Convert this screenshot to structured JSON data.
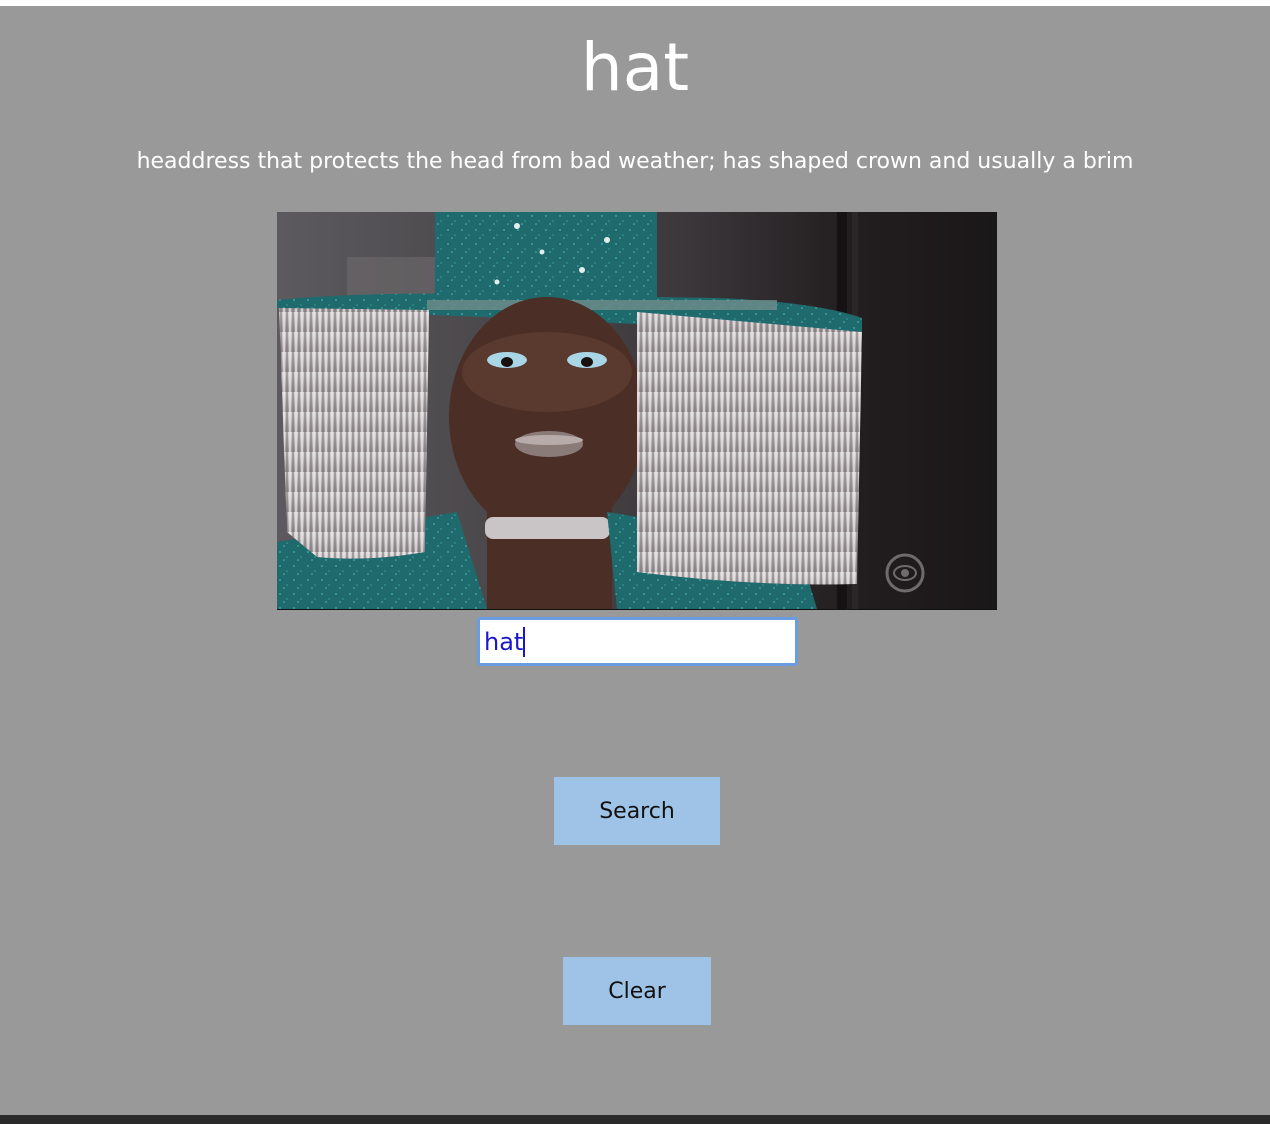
{
  "word": {
    "title": "hat",
    "definition": "headdress that protects the head from bad weather; has shaped crown and usually a brim"
  },
  "media": {
    "description_icon": "gif-image"
  },
  "search": {
    "value": "hat",
    "accent_color": "#6a9de0",
    "text_color": "#1a17c8"
  },
  "buttons": {
    "search_label": "Search",
    "clear_label": "Clear",
    "color": "#9fc3e6"
  },
  "colors": {
    "background": "#999999",
    "text": "#ffffff",
    "footer": "#2a2a2a"
  }
}
